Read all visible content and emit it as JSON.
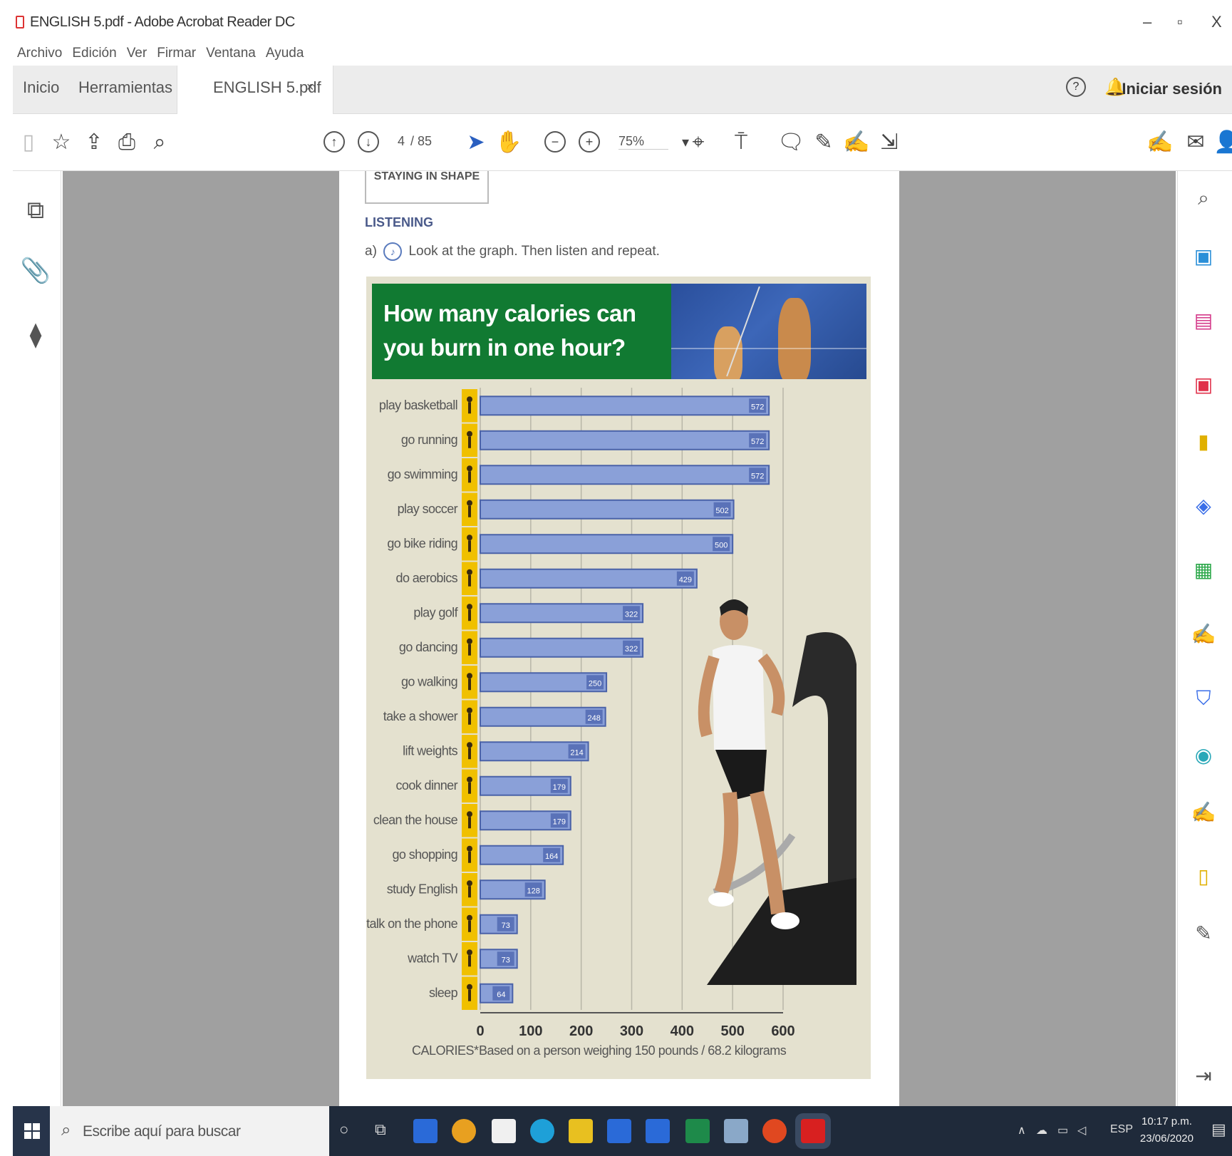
{
  "window": {
    "title": "ENGLISH 5.pdf - Adobe Acrobat Reader DC",
    "controls": [
      "–",
      "▫",
      "X"
    ]
  },
  "menu": [
    "Archivo",
    "Edición",
    "Ver",
    "Firmar",
    "Ventana",
    "Ayuda"
  ],
  "tabs": {
    "home": "Inicio",
    "tools": "Herramientas",
    "document": "ENGLISH 5.pdf",
    "close": "×",
    "login": "Iniciar sesión"
  },
  "toolbar": {
    "page_current": "4",
    "page_total": "/ 85",
    "zoom": "75%"
  },
  "document": {
    "section_box": "STAYING IN SHAPE",
    "listening_heading": "LISTENING",
    "instruction_prefix": "a)",
    "instruction": "Look at the graph. Then listen and repeat.",
    "graph_title": "How many calories can you burn in one hour?",
    "calories_label": "CALORIES*",
    "note": "Based on a person weighing 150 pounds / 68.2 kilograms"
  },
  "chart_data": {
    "type": "bar",
    "orientation": "horizontal",
    "title": "How many calories can you burn in one hour?",
    "xlabel": "CALORIES*",
    "xlim": [
      0,
      600
    ],
    "xticks": [
      0,
      100,
      200,
      300,
      400,
      500,
      600
    ],
    "grid": true,
    "categories": [
      "play basketball",
      "go running",
      "go swimming",
      "play soccer",
      "go bike riding",
      "do aerobics",
      "play golf",
      "go dancing",
      "go walking",
      "take a shower",
      "lift weights",
      "cook dinner",
      "clean the house",
      "go shopping",
      "study English",
      "talk on the phone",
      "watch TV",
      "sleep"
    ],
    "values": [
      572,
      572,
      572,
      502,
      500,
      429,
      322,
      322,
      250,
      248,
      214,
      179,
      179,
      164,
      128,
      73,
      73,
      64
    ],
    "colors": {
      "bar": "#8aa0d8",
      "bar_edge": "#4a62a8",
      "icon_bg": "#f0c000",
      "title_bg": "#117a32"
    }
  },
  "taskbar": {
    "search_placeholder": "Escribe aquí para buscar",
    "time": "10:17 p.m.",
    "date": "23/06/2020",
    "lang": "ESP"
  }
}
